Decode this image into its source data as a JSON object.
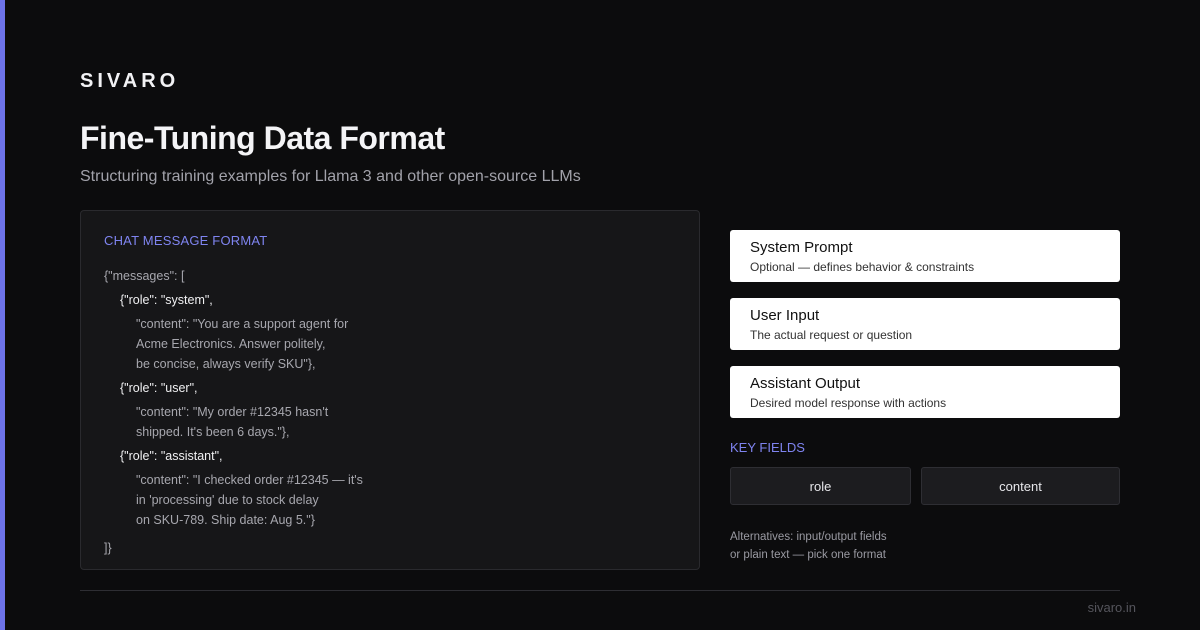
{
  "brand": "SIVARO",
  "title": "Fine-Tuning Data Format",
  "subtitle": "Structuring training examples for Llama 3 and other open-source LLMs",
  "code_panel": {
    "label": "CHAT MESSAGE FORMAT",
    "lines": [
      "{\"messages\": [",
      "{\"role\": \"system\",",
      "\"content\": \"You are a support agent for",
      "Acme Electronics. Answer politely,",
      "be concise, always verify SKU\"},",
      "{\"role\": \"user\",",
      "\"content\": \"My order #12345 hasn't",
      "shipped. It's been 6 days.\"},",
      "{\"role\": \"assistant\",",
      "\"content\": \"I checked order #12345 — it's",
      "in 'processing' due to stock delay",
      "on SKU-789. Ship date: Aug 5.\"}",
      "]}"
    ]
  },
  "cards": [
    {
      "heading": "System Prompt",
      "desc": "Optional — defines behavior & constraints"
    },
    {
      "heading": "User Input",
      "desc": "The actual request or question"
    },
    {
      "heading": "Assistant Output",
      "desc": "Desired model response with actions"
    }
  ],
  "key_fields": {
    "label": "KEY FIELDS",
    "items": [
      "role",
      "content"
    ]
  },
  "alternatives": {
    "line1": "Alternatives: input/output fields",
    "line2": "or plain text — pick one format"
  },
  "footer_url": "sivaro.in",
  "colors": {
    "background": "#0c0c0d",
    "accent": "#6d73e8",
    "label": "#7f84f0",
    "card": "#ffffff"
  }
}
